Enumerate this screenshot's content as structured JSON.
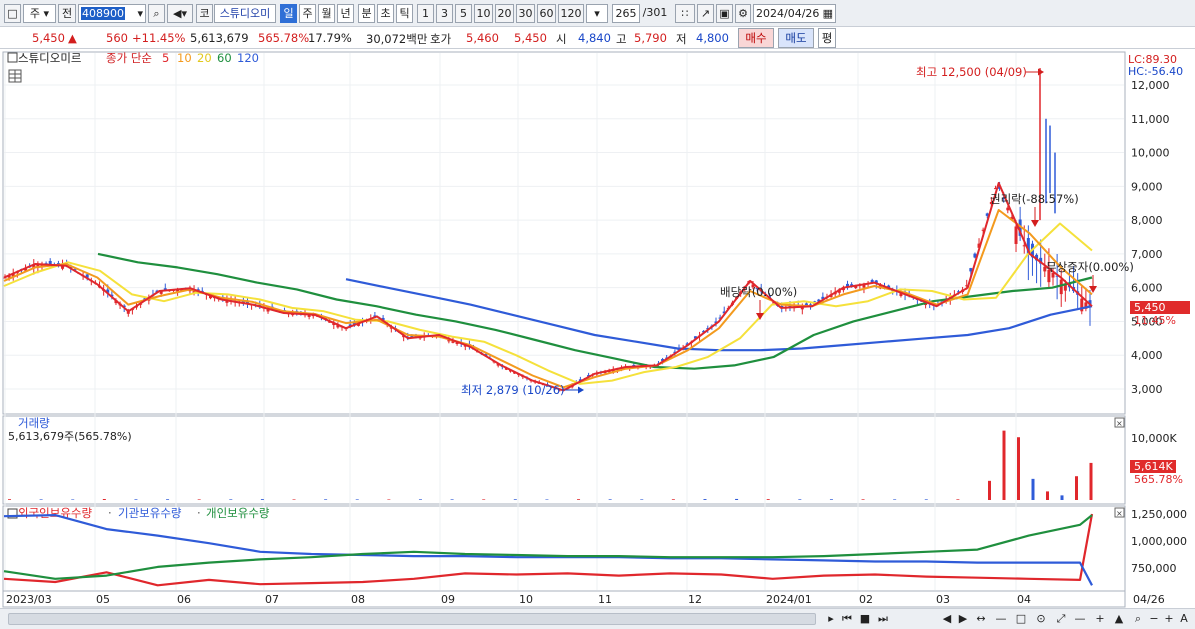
{
  "toolbar": {
    "market": "주",
    "all": "전",
    "code": "408900",
    "kospi": "코",
    "name": "스튜디오미",
    "periods": [
      "일",
      "주",
      "월",
      "년",
      "분",
      "초",
      "틱"
    ],
    "selected_period": "일",
    "units": [
      "1",
      "3",
      "5",
      "10",
      "20",
      "30",
      "60",
      "120"
    ],
    "count": "265",
    "total": "/301",
    "date": "2024/04/26"
  },
  "pricebar": {
    "price": "5,450",
    "change_arrow": "▲",
    "change": "560",
    "change_pct": "+11.45%",
    "volume": "5,613,679",
    "volume_ratio": "565.78%",
    "turnover": "17.79%",
    "amount": "30,072백만",
    "hoga_label": "호가",
    "ask": "5,460",
    "bid": "5,450",
    "open_label": "시",
    "open": "4,840",
    "high_label": "고",
    "high": "5,790",
    "low_label": "저",
    "low": "4,800",
    "buy": "매수",
    "sell": "매도",
    "flat": "평"
  },
  "legend": {
    "name": "스튜디오미르",
    "price_line": "종가 단순",
    "ma": [
      "5",
      "10",
      "20",
      "60",
      "120"
    ],
    "ma_colors": [
      "#e0272c",
      "#f39a1e",
      "#f5e13b",
      "#1f8f3e",
      "#2f5bd8"
    ]
  },
  "volume_legend": {
    "title": "거래량",
    "value": "5,613,679주(565.78%)"
  },
  "holdings_legend": {
    "series": [
      "외국인보유수량",
      "기관보유수량",
      "개인보유수량"
    ],
    "colors": [
      "#e0272c",
      "#2f5bd8",
      "#1f8f3e"
    ]
  },
  "price_panel": {
    "lc": "LC:89.30",
    "hc": "HC:-56.40",
    "y_ticks": [
      "12,000",
      "11,000",
      "10,000",
      "9,000",
      "8,000",
      "7,000",
      "6,000",
      "5,000",
      "4,000",
      "3,000"
    ],
    "current_price": "5,450",
    "current_pct": "11.45%",
    "high_annotation": "최고 12,500 (04/09)",
    "low_annotation": "최저 2,879 (10/26)",
    "dividend": "배당락(0.00%)",
    "rights": "권리락(-88.57%)",
    "bonus": "무상증자(0.00%)"
  },
  "volume_panel": {
    "y_tick": "10,000K",
    "current": "5,614K",
    "current_pct": "565.78%"
  },
  "holdings_panel": {
    "y_ticks": [
      "1,250,000",
      "1,000,000",
      "750,000"
    ]
  },
  "x_axis": {
    "labels": [
      "2023/03",
      "05",
      "06",
      "07",
      "08",
      "09",
      "10",
      "11",
      "12",
      "2024/01",
      "02",
      "03",
      "04"
    ],
    "last_date": "04/26"
  },
  "chart_data": [
    {
      "type": "line",
      "title": "",
      "series": [
        {
          "name": "5",
          "values": [
            6300,
            6700,
            6650,
            6100,
            5300,
            5900,
            5980,
            5650,
            5500,
            5250,
            5200,
            4800,
            5150,
            4500,
            4600,
            4250,
            3700,
            3250,
            2960,
            3450,
            3650,
            3700,
            4300,
            5000,
            6200,
            5400,
            5450,
            6000,
            6150,
            5800,
            5450,
            6000,
            9100,
            7000,
            6300,
            5450
          ]
        },
        {
          "name": "10",
          "values": [
            6200,
            6600,
            6700,
            6300,
            5500,
            5750,
            5950,
            5700,
            5580,
            5300,
            5220,
            4950,
            5050,
            4600,
            4550,
            4300,
            3850,
            3400,
            3050,
            3350,
            3600,
            3700,
            4150,
            4800,
            5900,
            5500,
            5450,
            5800,
            6050,
            5850,
            5500,
            5800,
            8300,
            7600,
            6600,
            5800
          ]
        },
        {
          "name": "20",
          "values": [
            6050,
            6450,
            6750,
            6500,
            5800,
            5600,
            5850,
            5800,
            5650,
            5400,
            5300,
            5050,
            5000,
            4750,
            4550,
            4400,
            4000,
            3550,
            3150,
            3250,
            3500,
            3650,
            3950,
            4500,
            5500,
            5600,
            5450,
            5600,
            5950,
            5900,
            5650,
            5700,
            7000,
            7900,
            7100
          ]
        },
        {
          "name": "60",
          "values": [
            7000,
            6750,
            6600,
            6400,
            6150,
            5950,
            5650,
            5450,
            5200,
            5000,
            4750,
            4450,
            4150,
            3900,
            3650,
            3600,
            3700,
            3950,
            4600,
            5000,
            5300,
            5600,
            5750,
            5900,
            6000,
            6300
          ]
        },
        {
          "name": "120",
          "values": [
            6250,
            6000,
            5750,
            5500,
            5200,
            4900,
            4600,
            4400,
            4200,
            4150,
            4150,
            4200,
            4300,
            4400,
            4500,
            4600,
            4800,
            5200,
            5450
          ]
        }
      ]
    },
    {
      "type": "bar",
      "title": "",
      "series": [
        {
          "name": "거래량",
          "values": [
            120,
            90,
            80,
            150,
            100,
            110,
            90,
            95,
            130,
            85,
            100,
            90,
            80,
            100,
            95,
            90,
            110,
            80,
            120,
            100,
            90,
            110,
            140,
            160,
            130,
            100,
            110,
            100,
            90,
            95,
            100,
            95,
            2900,
            10500,
            9500,
            3200,
            1300,
            700,
            3600,
            5614
          ]
        }
      ]
    },
    {
      "type": "line",
      "title": "",
      "series": [
        {
          "name": "외국인보유수량",
          "values": [
            650000,
            620000,
            710000,
            590000,
            640000,
            600000,
            610000,
            620000,
            650000,
            700000,
            690000,
            700000,
            680000,
            700000,
            690000,
            650000,
            680000,
            690000,
            670000,
            660000,
            650000,
            640000,
            1250000
          ]
        },
        {
          "name": "기관보유수량",
          "values": [
            1230000,
            1240000,
            1110000,
            1050000,
            980000,
            900000,
            880000,
            870000,
            860000,
            860000,
            850000,
            850000,
            850000,
            840000,
            840000,
            830000,
            820000,
            810000,
            810000,
            800000,
            800000,
            800000,
            590000
          ]
        },
        {
          "name": "개인보유수량",
          "values": [
            720000,
            650000,
            680000,
            760000,
            800000,
            830000,
            850000,
            880000,
            900000,
            880000,
            870000,
            860000,
            860000,
            850000,
            850000,
            850000,
            860000,
            880000,
            900000,
            920000,
            1050000,
            1150000,
            1240000
          ]
        }
      ]
    }
  ]
}
